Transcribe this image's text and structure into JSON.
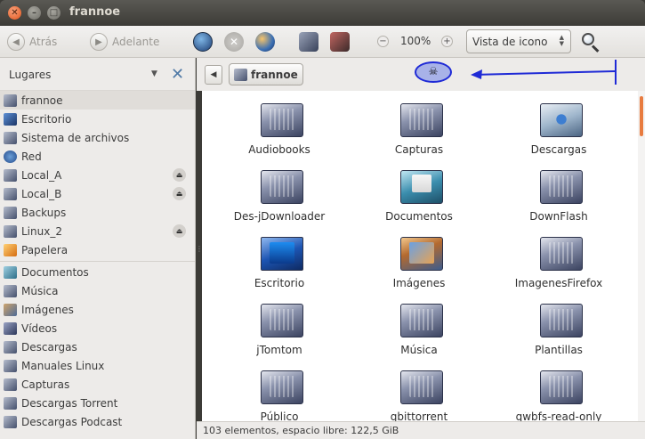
{
  "window": {
    "title": "frannoe"
  },
  "toolbar": {
    "back_label": "Atrás",
    "forward_label": "Adelante",
    "zoom": "100%",
    "view_mode": "Vista de icono"
  },
  "sidebar": {
    "header": "Lugares",
    "places": [
      {
        "label": "frannoe",
        "icon": "home-folder-icon",
        "selected": true
      },
      {
        "label": "Escritorio",
        "icon": "desktop-icon"
      },
      {
        "label": "Sistema de archivos",
        "icon": "filesystem-icon"
      },
      {
        "label": "Red",
        "icon": "network-icon"
      },
      {
        "label": "Local_A",
        "icon": "drive-icon",
        "eject": true
      },
      {
        "label": "Local_B",
        "icon": "drive-icon",
        "eject": true
      },
      {
        "label": "Backups",
        "icon": "drive-icon"
      },
      {
        "label": "Linux_2",
        "icon": "drive-icon",
        "eject": true
      },
      {
        "label": "Papelera",
        "icon": "trash-icon"
      }
    ],
    "bookmarks": [
      {
        "label": "Documentos",
        "icon": "documents-folder-icon"
      },
      {
        "label": "Música",
        "icon": "folder-icon"
      },
      {
        "label": "Imágenes",
        "icon": "pictures-folder-icon"
      },
      {
        "label": "Vídeos",
        "icon": "videos-folder-icon"
      },
      {
        "label": "Descargas",
        "icon": "folder-icon"
      },
      {
        "label": "Manuales Linux",
        "icon": "folder-icon"
      },
      {
        "label": "Capturas",
        "icon": "folder-icon"
      },
      {
        "label": "Descargas Torrent",
        "icon": "folder-icon"
      },
      {
        "label": "Descargas Podcast",
        "icon": "folder-icon"
      }
    ]
  },
  "location": {
    "crumb": "frannoe",
    "annotation_icon": "☠"
  },
  "files": [
    {
      "name": "Audiobooks",
      "type": "folder"
    },
    {
      "name": "Capturas",
      "type": "folder"
    },
    {
      "name": "Descargas",
      "type": "downloads"
    },
    {
      "name": "Des-jDownloader",
      "type": "folder"
    },
    {
      "name": "Documentos",
      "type": "docs"
    },
    {
      "name": "DownFlash",
      "type": "folder"
    },
    {
      "name": "Escritorio",
      "type": "screen"
    },
    {
      "name": "Imágenes",
      "type": "pics"
    },
    {
      "name": "ImagenesFirefox",
      "type": "folder"
    },
    {
      "name": "jTomtom",
      "type": "folder"
    },
    {
      "name": "Música",
      "type": "folder"
    },
    {
      "name": "Plantillas",
      "type": "folder"
    },
    {
      "name": "Público",
      "type": "folder"
    },
    {
      "name": "qbittorrent",
      "type": "folder"
    },
    {
      "name": "qwbfs-read-only",
      "type": "folder"
    }
  ],
  "status": {
    "text": "103 elementos, espacio libre: 122,5 GiB"
  },
  "colors": {
    "accent": "#e87b3f",
    "annotation": "#1f2ad6"
  }
}
